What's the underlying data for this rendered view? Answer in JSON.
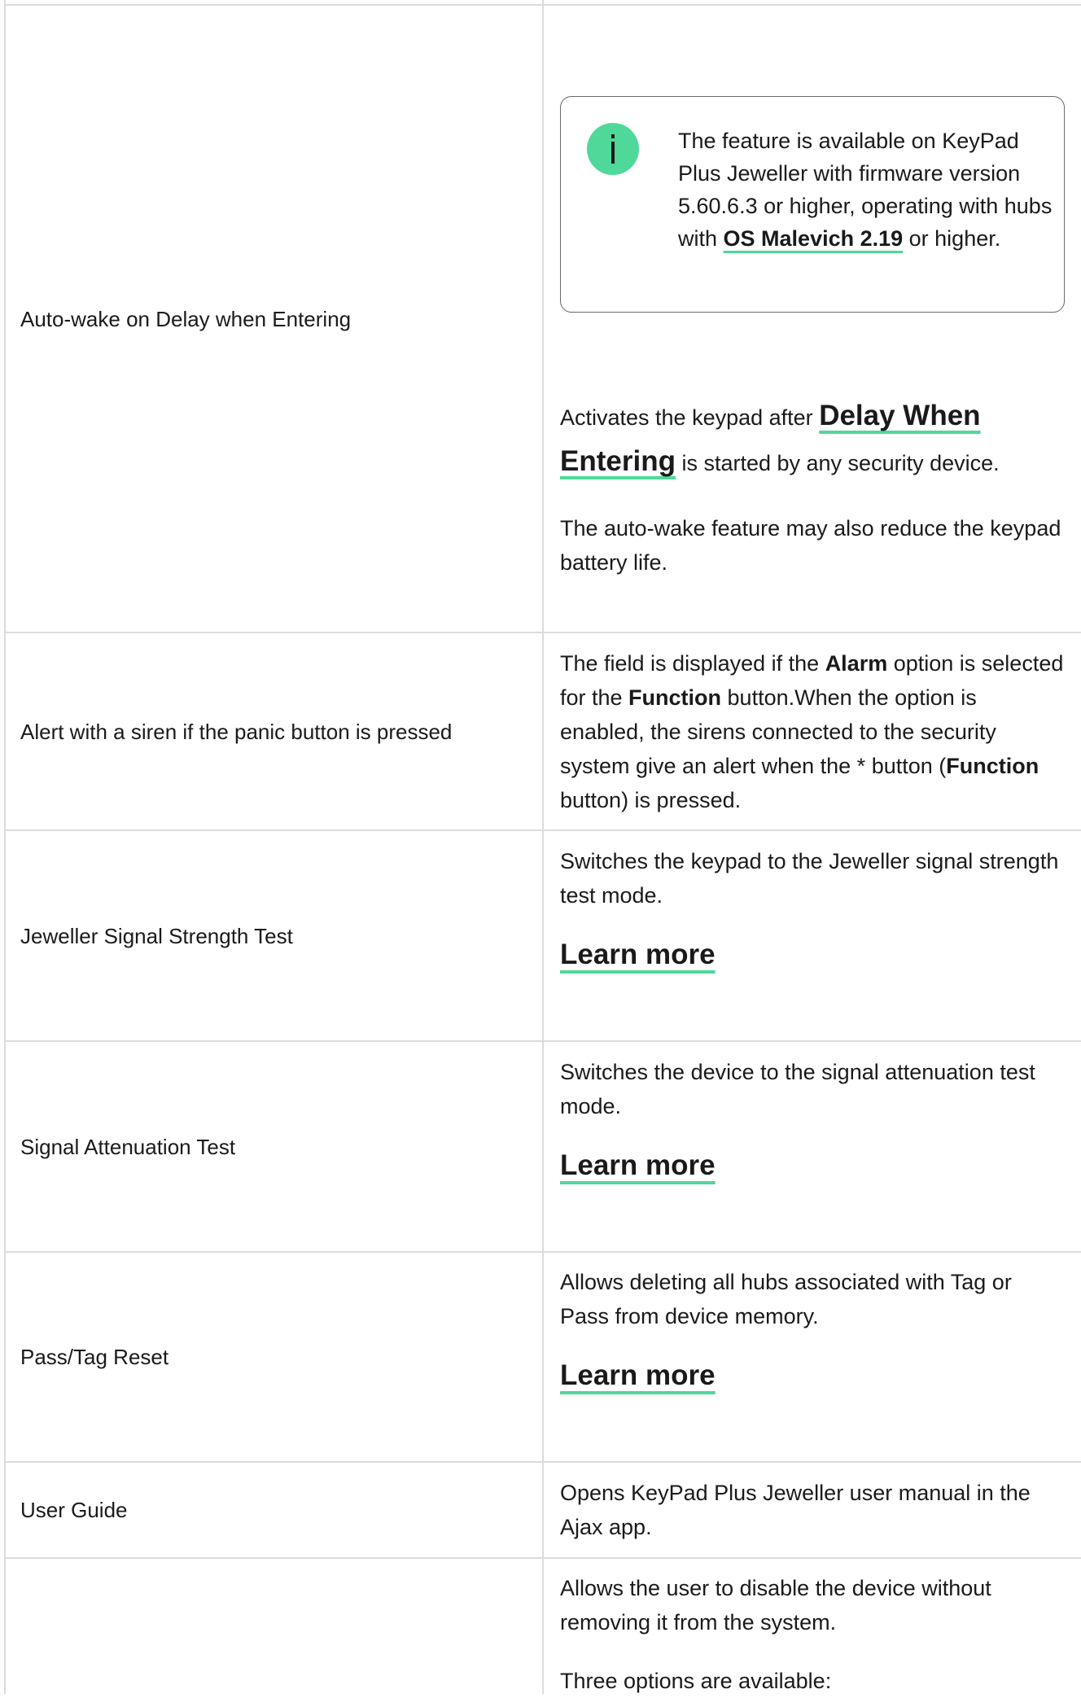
{
  "rows": [
    {
      "name": "Auto-wake on Delay when Entering",
      "note": {
        "before": "The feature is available on KeyPad Plus Jeweller with firmware version 5.60.6.3 or higher, operating with hubs with ",
        "link": "OS Malevich 2.19",
        "after": " or higher."
      },
      "para1_before": "Activates the keypad after ",
      "para1_link": "Delay When Entering",
      "para1_after": " is started by any security device.",
      "para2": "The auto-wake feature may also reduce the keypad battery life."
    },
    {
      "name": "Alert with a siren if the panic button is pressed",
      "t1": "The field is displayed if the ",
      "b1": "Alarm",
      "t2": " option is selected for the ",
      "b2": "Function",
      "t3": " button.When the option is enabled, the sirens connected to the security system give an alert when the * button (",
      "b3": "Function",
      "t4": " button) is pressed."
    },
    {
      "name": "Jeweller Signal Strength Test",
      "desc": "Switches the keypad to the Jeweller signal strength test mode.",
      "link": "Learn more"
    },
    {
      "name": "Signal Attenuation Test",
      "desc": "Switches the device to the signal attenuation test mode.",
      "link": "Learn more"
    },
    {
      "name": "Pass/Tag Reset",
      "desc": "Allows deleting all hubs associated with Tag or Pass from device memory.",
      "link": "Learn more"
    },
    {
      "name": "User Guide",
      "desc": "Opens KeyPad Plus Jeweller user manual in the Ajax app."
    },
    {
      "name": "",
      "desc": "Allows the user to disable the device without removing it from the system.",
      "partial": "Three options are available:"
    }
  ]
}
